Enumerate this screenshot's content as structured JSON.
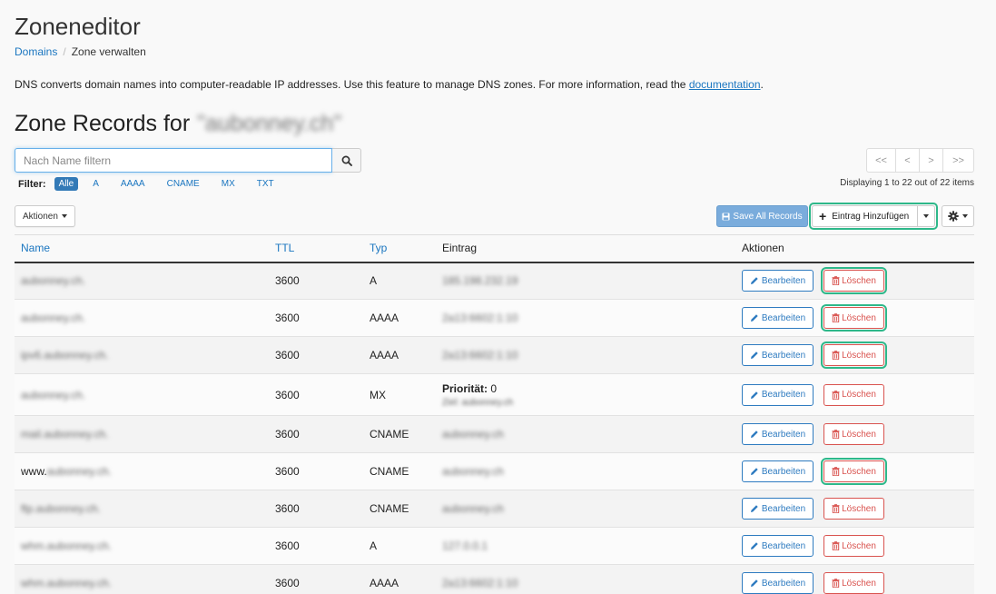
{
  "page_title": "Zoneneditor",
  "breadcrumb": {
    "domains": "Domains",
    "current": "Zone verwalten"
  },
  "intro": {
    "text": "DNS converts domain names into computer-readable IP addresses. Use this feature to manage DNS zones. For more information, read the ",
    "link": "documentation",
    "end": "."
  },
  "section": {
    "title": "Zone Records for",
    "domain": "\"aubonney.ch\""
  },
  "search": {
    "placeholder": "Nach Name filtern",
    "icon": "search-icon"
  },
  "filter": {
    "label": "Filter:",
    "options": [
      "Alle",
      "A",
      "AAAA",
      "CNAME",
      "MX",
      "TXT"
    ],
    "active": "Alle"
  },
  "pager": {
    "first": "<<",
    "prev": "<",
    "next": ">",
    "last": ">>",
    "info": "Displaying 1 to 22 out of 22 items"
  },
  "toolbar": {
    "actions_label": "Aktionen",
    "save_all": "Save All Records",
    "add_entry": "Eintrag Hinzufügen",
    "gear_icon": "gear-icon"
  },
  "table": {
    "headers": {
      "name": "Name",
      "ttl": "TTL",
      "type": "Typ",
      "entry": "Eintrag",
      "actions": "Aktionen"
    },
    "edit_label": "Bearbeiten",
    "delete_label": "Löschen",
    "highlight_color": "#2eb88a",
    "rows": [
      {
        "name": "aubonney.ch.",
        "ttl": "3600",
        "type": "A",
        "entry": "185.198.232.19",
        "highlight_delete": true
      },
      {
        "name": "aubonney.ch.",
        "ttl": "3600",
        "type": "AAAA",
        "entry": "2a13:6602:1:10",
        "highlight_delete": true
      },
      {
        "name": "ipv6.aubonney.ch.",
        "ttl": "3600",
        "type": "AAAA",
        "entry": "2a13:6602:1:10",
        "highlight_delete": true
      },
      {
        "name": "aubonney.ch.",
        "ttl": "3600",
        "type": "MX",
        "mx_priority_label": "Priorität:",
        "mx_priority": "0",
        "mx_target": "Ziel: aubonney.ch",
        "highlight_delete": false
      },
      {
        "name": "mail.aubonney.ch.",
        "ttl": "3600",
        "type": "CNAME",
        "entry": "aubonney.ch",
        "highlight_delete": false
      },
      {
        "name_prefix": "www.",
        "name": "aubonney.ch.",
        "ttl": "3600",
        "type": "CNAME",
        "entry": "aubonney.ch",
        "highlight_delete": true
      },
      {
        "name": "ftp.aubonney.ch.",
        "ttl": "3600",
        "type": "CNAME",
        "entry": "aubonney.ch",
        "highlight_delete": false
      },
      {
        "name": "whm.aubonney.ch.",
        "ttl": "3600",
        "type": "A",
        "entry": "127.0.0.1",
        "highlight_delete": false
      },
      {
        "name": "whm.aubonney.ch.",
        "ttl": "3600",
        "type": "AAAA",
        "entry": "2a13:6602:1:10",
        "highlight_delete": false
      }
    ]
  }
}
